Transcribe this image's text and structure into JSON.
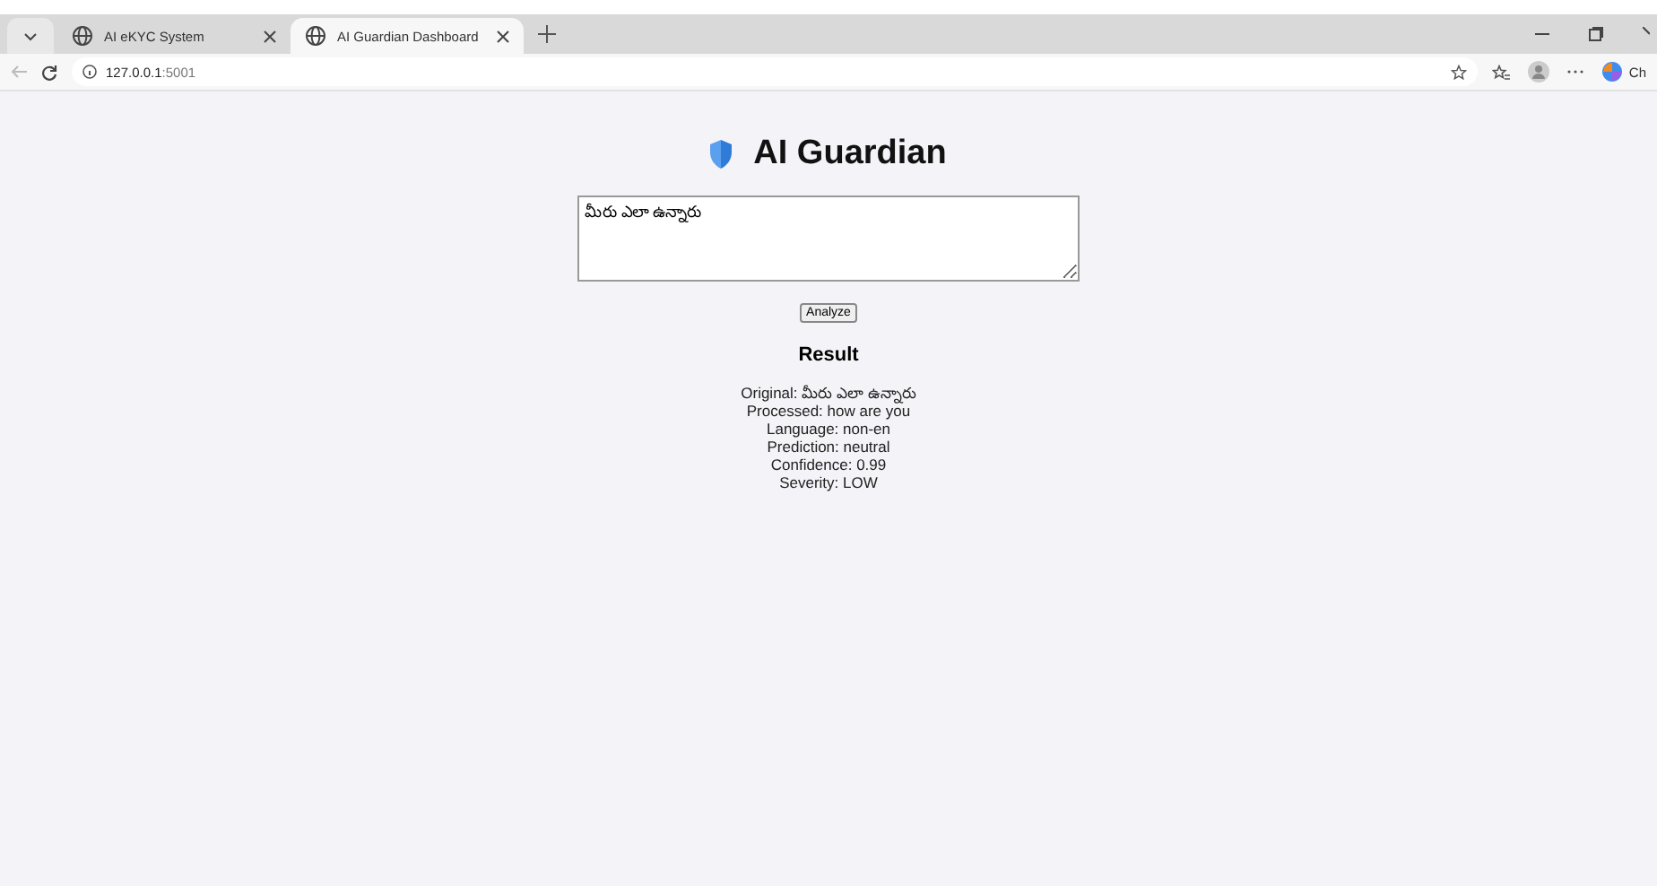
{
  "browser": {
    "tabs": [
      {
        "title": "AI eKYC System",
        "selected": false
      },
      {
        "title": "AI Guardian Dashboard",
        "selected": true
      }
    ],
    "address": {
      "host": "127.0.0.1",
      "port": ":5001"
    },
    "copilot_label": "Ch"
  },
  "page": {
    "title": "AI Guardian",
    "input": {
      "value": "మీరు ఎలా ఉన్నారు"
    },
    "analyze_button": "Analyze",
    "result": {
      "heading": "Result",
      "lines": [
        "Original: మీరు ఎలా ఉన్నారు",
        "Processed: how are you",
        "Language: non-en",
        "Prediction: neutral",
        "Confidence: 0.99",
        "Severity: LOW"
      ]
    }
  }
}
